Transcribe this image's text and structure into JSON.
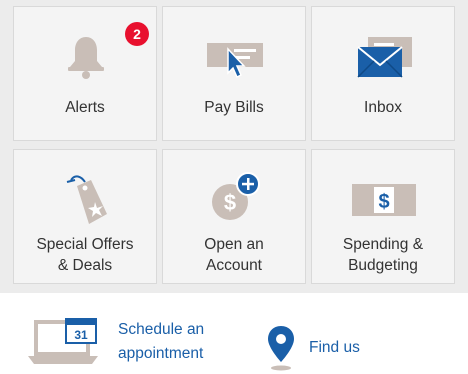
{
  "tiles": [
    {
      "label": "Alerts",
      "icon": "bell-icon",
      "badge": "2"
    },
    {
      "label": "Pay Bills",
      "icon": "pay-bills-icon"
    },
    {
      "label": "Inbox",
      "icon": "envelope-icon"
    },
    {
      "label_line1": "Special Offers",
      "label_line2": "& Deals",
      "icon": "tag-icon"
    },
    {
      "label_line1": "Open an",
      "label_line2": "Account",
      "icon": "open-account-icon"
    },
    {
      "label_line1": "Spending &",
      "label_line2": "Budgeting",
      "icon": "dollar-bill-icon"
    }
  ],
  "footer": {
    "schedule": {
      "line1": "Schedule an",
      "line2": "appointment",
      "icon": "calendar-laptop-icon",
      "calendar_day": "31"
    },
    "find_us": {
      "label": "Find us",
      "icon": "location-pin-icon"
    }
  },
  "colors": {
    "icon_gray": "#c9beb7",
    "accent_blue": "#1a5fa8",
    "badge_red": "#e8102e",
    "tile_bg": "#f4f4f4"
  }
}
